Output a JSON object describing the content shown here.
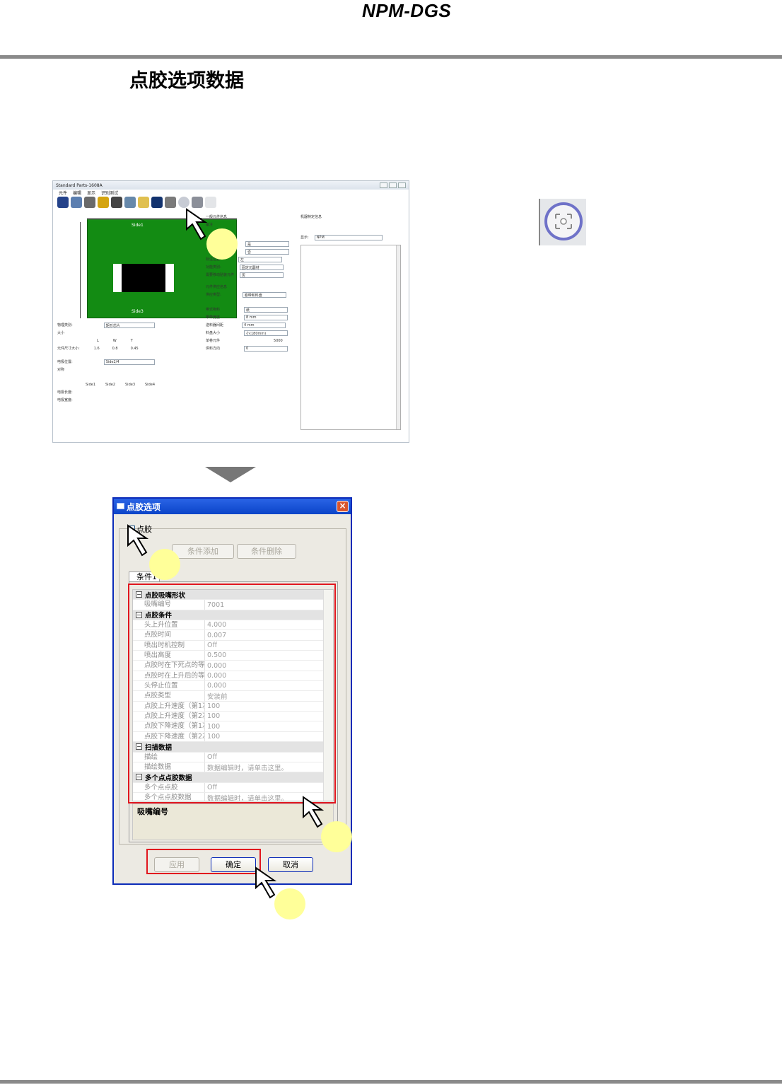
{
  "header": {
    "brand": "NPM-DGS"
  },
  "page_title": "点胶选项数据",
  "app_window": {
    "title": "Standard Parts-1608A",
    "menu": [
      "元件",
      "编辑",
      "显示",
      "识别测试"
    ],
    "side_top": "Side1",
    "side_bottom": "Side3",
    "side_left": "Side4",
    "side_right": "Side2",
    "group_general": "一般元件信息",
    "group_supply": "元件供应信息",
    "group_machine": "机器特定信息",
    "machine_label": "显示:",
    "machine_value": "NPM",
    "rows_left": [
      "物理类别:",
      "大小",
      "L",
      "W",
      "T",
      "元件尺寸大小:",
      "电极位置:",
      "对称"
    ],
    "size_values": [
      "1.6",
      "0.8",
      "0.45"
    ],
    "electrode_value": "Side2/4",
    "side_headers": [
      "Side1",
      "Side2",
      "Side3",
      "Side4"
    ],
    "electrode_len_label": "电极长度:",
    "electrode_width_label": "电极宽度:",
    "supply_type": "供应类型:",
    "supply_value": "卷带和料盘",
    "tape_rows": [
      "带式物料",
      "带带宽度",
      "送料器间距",
      "料盘大小",
      "单卷元件",
      "供料方向"
    ],
    "tape_values": [
      "纸",
      "8 mm",
      "4 mm",
      "小(180mm)",
      "5000",
      "0"
    ],
    "general_rows": [
      "备注",
      "",
      "",
      "标注位置",
      "功能类别:",
      "需要移动贴装元件"
    ],
    "general_values": [
      "",
      "是",
      "否",
      "左",
      "固定元器材",
      "否"
    ],
    "physical_value": "矩形芯片"
  },
  "zoom_icon": "zoom-fit-icon",
  "dialog": {
    "title": "点胶选项",
    "close": "×",
    "checkbox_label": "点胶",
    "add_button": "条件添加",
    "delete_button": "条件删除",
    "tab_label": "条件1",
    "rows": [
      {
        "cat": true,
        "label": "点胶吸嘴形状"
      },
      {
        "key": "吸嘴编号",
        "val": "7001"
      },
      {
        "cat": true,
        "label": "点胶条件"
      },
      {
        "key": "头上升位置",
        "val": "4.000"
      },
      {
        "key": "点胶时间",
        "val": "0.007"
      },
      {
        "key": "喷出时机控制",
        "val": "Off"
      },
      {
        "key": "喷出高度",
        "val": "0.500"
      },
      {
        "key": "点胶时在下死点的等待",
        "val": "0.000"
      },
      {
        "key": "点胶时在上升后的等待",
        "val": "0.000"
      },
      {
        "key": "头停止位置",
        "val": "0.000"
      },
      {
        "key": "点胶类型",
        "val": "安装前"
      },
      {
        "key": "点胶上升速度（第1次）",
        "val": "100"
      },
      {
        "key": "点胶上升速度（第2次）",
        "val": "100"
      },
      {
        "key": "点胶下降速度（第1次）",
        "val": "100"
      },
      {
        "key": "点胶下降速度（第2次）",
        "val": "100"
      },
      {
        "cat": true,
        "label": "扫描数据"
      },
      {
        "key": "描绘",
        "val": "Off"
      },
      {
        "key": "描绘数据",
        "val": "数据编辑时，请单击这里。"
      },
      {
        "cat": true,
        "label": "多个点点胶数据"
      },
      {
        "key": "多个点点胶",
        "val": "Off"
      },
      {
        "key": "多个点点胶数据",
        "val": "数据编辑时，请单击这里。"
      }
    ],
    "description": "吸嘴编号",
    "apply_button": "应用",
    "ok_button": "确定",
    "cancel_button": "取消"
  }
}
